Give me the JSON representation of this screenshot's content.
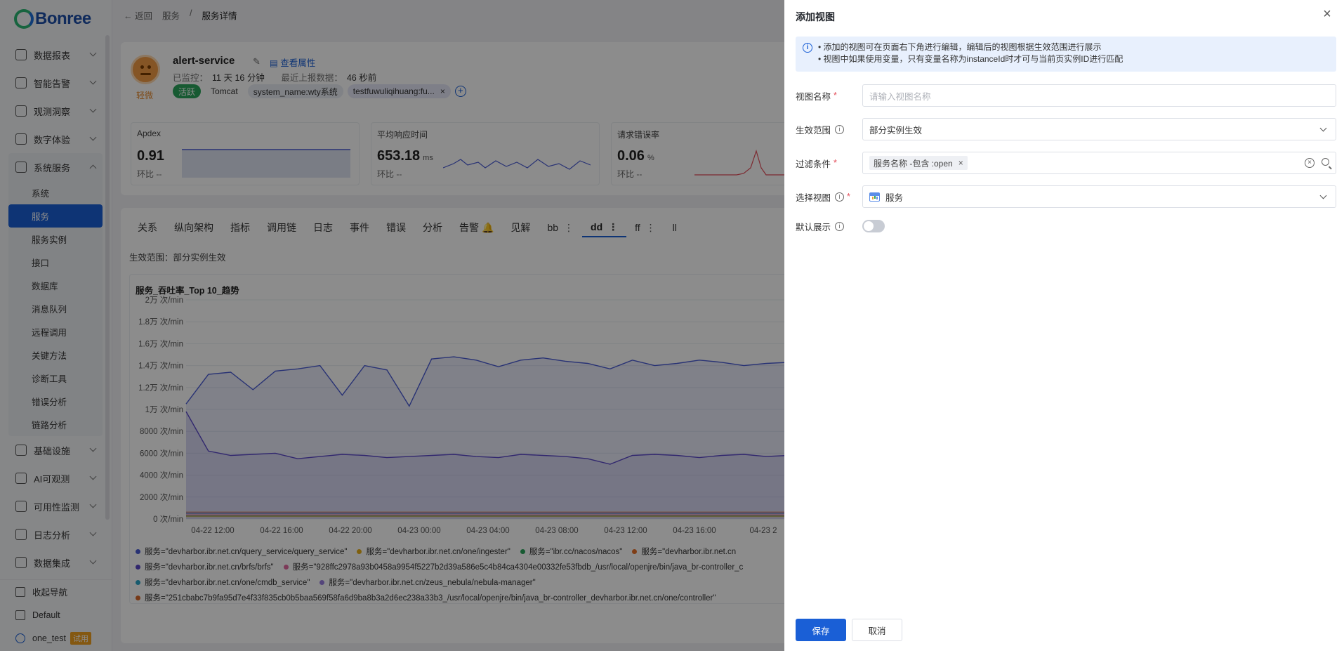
{
  "brand": {
    "name": "Bonree"
  },
  "sidebar": {
    "items": [
      {
        "label": "数据报表"
      },
      {
        "label": "智能告警"
      },
      {
        "label": "观测洞察"
      },
      {
        "label": "数字体验"
      },
      {
        "label": "系统服务"
      }
    ],
    "sub_items": [
      {
        "label": "系统"
      },
      {
        "label": "服务"
      },
      {
        "label": "服务实例"
      },
      {
        "label": "接口"
      },
      {
        "label": "数据库"
      },
      {
        "label": "消息队列"
      },
      {
        "label": "远程调用"
      },
      {
        "label": "关键方法"
      },
      {
        "label": "诊断工具"
      },
      {
        "label": "错误分析"
      },
      {
        "label": "链路分析"
      }
    ],
    "items_after": [
      {
        "label": "基础设施"
      },
      {
        "label": "AI可观测"
      },
      {
        "label": "可用性监测"
      },
      {
        "label": "日志分析"
      },
      {
        "label": "数据集成"
      }
    ],
    "collapse_label": "收起导航",
    "workspace": "Default",
    "user": "one_test",
    "user_badge": "试用"
  },
  "breadcrumb": {
    "back": "返回",
    "parent": "服务",
    "current": "服务详情"
  },
  "service": {
    "name": "alert-service",
    "attr_link": "查看属性",
    "level": "轻微",
    "monitored_label": "已监控：",
    "monitored_value": "11 天 16 分钟",
    "last_report_label": "最近上报数据：",
    "last_report_value": "46 秒前",
    "tags": [
      "活跃",
      "Tomcat",
      "system_name:wty系统",
      "testfuwuliqihuang:fu..."
    ]
  },
  "metrics": [
    {
      "label": "Apdex",
      "value": "0.91",
      "unit": "",
      "compare": "环比  --"
    },
    {
      "label": "平均响应时间",
      "value": "653.18",
      "unit": "ms",
      "compare": "环比  --"
    },
    {
      "label": "请求错误率",
      "value": "0.06",
      "unit": "%",
      "compare": "环比  --"
    }
  ],
  "tabs": [
    "关系",
    "纵向架构",
    "指标",
    "调用链",
    "日志",
    "事件",
    "错误",
    "分析",
    "告警",
    "见解",
    "bb",
    "dd",
    "ff",
    "ll"
  ],
  "active_tab": "dd",
  "scope_text": "生效范围：部分实例生效",
  "chart_data": {
    "type": "line",
    "title": "服务_吞吐率_Top 10_趋势",
    "y_ticks": [
      "2万 次/min",
      "1.8万 次/min",
      "1.6万 次/min",
      "1.4万 次/min",
      "1.2万 次/min",
      "1万 次/min",
      "8000 次/min",
      "6000 次/min",
      "4000 次/min",
      "2000 次/min",
      "0 次/min"
    ],
    "x_ticks": [
      "04-22 12:00",
      "04-22 16:00",
      "04-22 20:00",
      "04-23 00:00",
      "04-23 04:00",
      "04-23 08:00",
      "04-23 12:00",
      "04-23 16:00",
      "04-23 2"
    ],
    "ylim": [
      0,
      20000
    ],
    "series": [
      {
        "name": "服务=\"devharbor.ibr.net.cn/query_service/query_service\"",
        "color": "#4a5bd4",
        "values": [
          10500,
          13200,
          13400,
          11800,
          13500,
          13700,
          14000,
          11300,
          14000,
          13600,
          10300,
          14600,
          14800,
          14500,
          13900,
          14500,
          14700,
          14400,
          14200,
          13700,
          14500,
          14000,
          14200,
          14500,
          14300,
          14000,
          14200,
          14300
        ]
      },
      {
        "name": "服务=\"devharbor.ibr.net.cn/one/ingester\"",
        "color": "#e8b019",
        "values": []
      },
      {
        "name": "服务=\"ibr.cc/nacos/nacos\"",
        "color": "#2ba55b",
        "values": []
      },
      {
        "name": "服务=\"devharbor.ibr.net.cn",
        "color": "#e8712a",
        "values": []
      },
      {
        "name": "服务=\"devharbor.ibr.net.cn/brfs/brfs\"",
        "color": "#5a48c8",
        "values": [
          9800,
          6200,
          5800,
          5900,
          6000,
          5500,
          5700,
          5900,
          5800,
          5600,
          5700,
          5800,
          5900,
          5700,
          5600,
          5900,
          5800,
          5700,
          5500,
          5000,
          5800,
          5900,
          5800,
          5600,
          5800,
          5900,
          5700,
          5800
        ]
      },
      {
        "name": "服务=\"928ffc2978a93b0458a9954f5227b2d39a586e5c4b84ca4304e00332fe53fbdb_/usr/local/openjre/bin/java_br-controller_c",
        "color": "#e26aa0",
        "values": []
      },
      {
        "name": "服务=\"devharbor.ibr.net.cn/one/cmdb_service\"",
        "color": "#2aa7c9",
        "values": []
      },
      {
        "name": "服务=\"devharbor.ibr.net.cn/zeus_nebula/nebula-manager\"",
        "color": "#9a7ee0",
        "values": []
      },
      {
        "name": "服务=\"251cbabc7b9fa95d7e4f33f835cb0b5baa569f58fa6d9ba8b3a2d6ec238a33b3_/usr/local/openjre/bin/java_br-controller_devharbor.ibr.net.cn/one/controller\"",
        "color": "#d9682a",
        "values": []
      }
    ]
  },
  "drawer": {
    "title": "添加视图",
    "notice_lines": [
      "• 添加的视图可在页面右下角进行编辑，编辑后的视图根据生效范围进行展示",
      "• 视图中如果使用变量，只有变量名称为instanceId时才可与当前页实例ID进行匹配"
    ],
    "fields": {
      "name_label": "视图名称",
      "name_placeholder": "请输入视图名称",
      "scope_label": "生效范围",
      "scope_value": "部分实例生效",
      "filter_label": "过滤条件",
      "filter_chip": "服务名称 -包含 :open",
      "view_label": "选择视图",
      "view_value": "服务",
      "default_label": "默认展示",
      "default_on": false
    },
    "save_label": "保存",
    "cancel_label": "取消"
  }
}
